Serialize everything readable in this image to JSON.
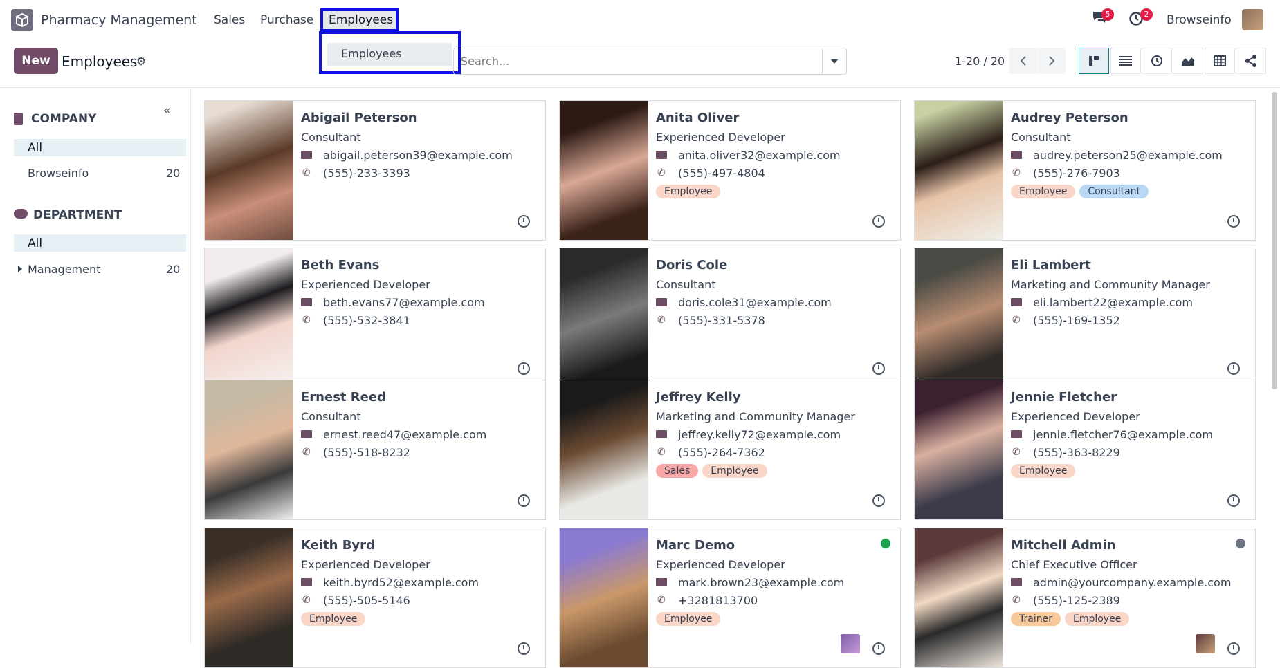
{
  "app": {
    "title": "Pharmacy Management"
  },
  "nav": {
    "items": [
      "Sales",
      "Purchase",
      "Employees"
    ]
  },
  "dropdown": {
    "item": "Employees"
  },
  "notifications": {
    "messages_count": "5",
    "activities_count": "2"
  },
  "user": {
    "name": "Browseinfo"
  },
  "control": {
    "new_label": "New",
    "title": "Employees",
    "search_placeholder": "Search...",
    "pager": "1-20 / 20"
  },
  "sidebar": {
    "company_heading": "COMPANY",
    "company_all": "All",
    "company_items": [
      {
        "label": "Browseinfo",
        "count": "20"
      }
    ],
    "department_heading": "DEPARTMENT",
    "department_all": "All",
    "department_items": [
      {
        "label": "Management",
        "count": "20"
      }
    ]
  },
  "colors": {
    "brand": "#714b67",
    "accent": "#017e84",
    "highlight": "#1010e0"
  },
  "employees": [
    {
      "name": "Abigail Peterson",
      "job": "Consultant",
      "email": "abigail.peterson39@example.com",
      "phone": "(555)-233-3393",
      "tags": []
    },
    {
      "name": "Anita Oliver",
      "job": "Experienced Developer",
      "email": "anita.oliver32@example.com",
      "phone": "(555)-497-4804",
      "tags": [
        "Employee"
      ]
    },
    {
      "name": "Audrey Peterson",
      "job": "Consultant",
      "email": "audrey.peterson25@example.com",
      "phone": "(555)-276-7903",
      "tags": [
        "Employee",
        "Consultant"
      ]
    },
    {
      "name": "Beth Evans",
      "job": "Experienced Developer",
      "email": "beth.evans77@example.com",
      "phone": "(555)-532-3841",
      "tags": []
    },
    {
      "name": "Doris Cole",
      "job": "Consultant",
      "email": "doris.cole31@example.com",
      "phone": "(555)-331-5378",
      "tags": []
    },
    {
      "name": "Eli Lambert",
      "job": "Marketing and Community Manager",
      "email": "eli.lambert22@example.com",
      "phone": "(555)-169-1352",
      "tags": []
    },
    {
      "name": "Ernest Reed",
      "job": "Consultant",
      "email": "ernest.reed47@example.com",
      "phone": "(555)-518-8232",
      "tags": []
    },
    {
      "name": "Jeffrey Kelly",
      "job": "Marketing and Community Manager",
      "email": "jeffrey.kelly72@example.com",
      "phone": "(555)-264-7362",
      "tags": [
        "Sales",
        "Employee"
      ]
    },
    {
      "name": "Jennie Fletcher",
      "job": "Experienced Developer",
      "email": "jennie.fletcher76@example.com",
      "phone": "(555)-363-8229",
      "tags": [
        "Employee"
      ]
    },
    {
      "name": "Keith Byrd",
      "job": "Experienced Developer",
      "email": "keith.byrd52@example.com",
      "phone": "(555)-505-5146",
      "tags": [
        "Employee"
      ]
    },
    {
      "name": "Marc Demo",
      "job": "Experienced Developer",
      "email": "mark.brown23@example.com",
      "phone": "+3281813700",
      "tags": [
        "Employee"
      ]
    },
    {
      "name": "Mitchell Admin",
      "job": "Chief Executive Officer",
      "email": "admin@yourcompany.example.com",
      "phone": "(555)-125-2389",
      "tags": [
        "Trainer",
        "Employee"
      ]
    }
  ]
}
